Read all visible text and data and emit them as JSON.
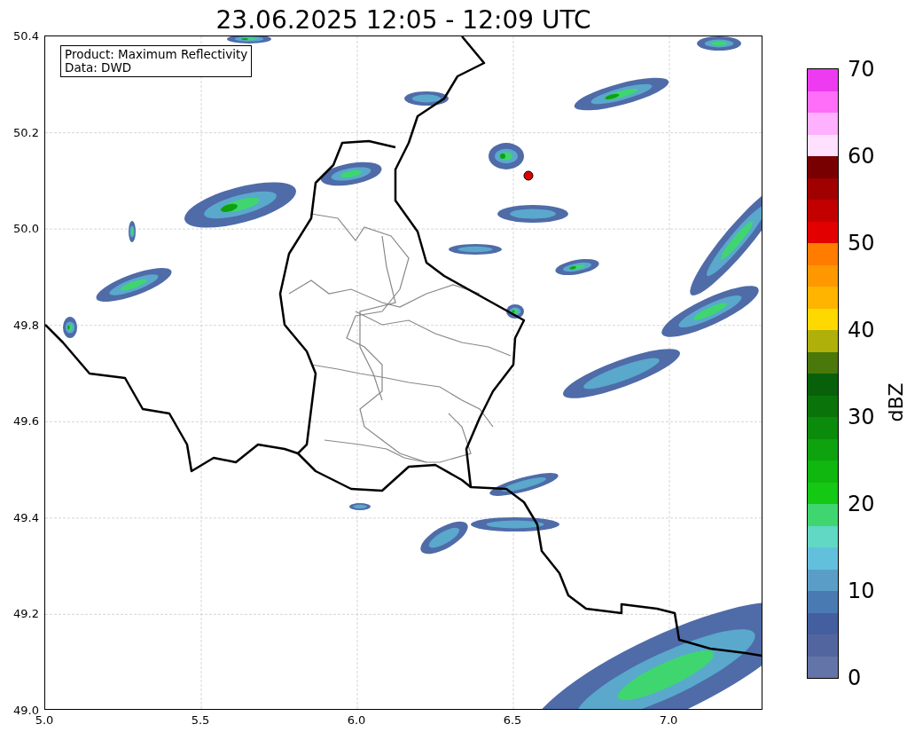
{
  "title": "23.06.2025 12:05 - 12:09 UTC",
  "info_box": {
    "lines": [
      "Product: Maximum Reflectivity",
      "Data: DWD"
    ]
  },
  "x_axis": {
    "ticks": [
      "5.0",
      "5.5",
      "6.0",
      "6.5",
      "7.0"
    ]
  },
  "y_axis": {
    "ticks": [
      "50.4",
      "50.2",
      "50.0",
      "49.8",
      "49.6",
      "49.4",
      "49.2",
      "49.0"
    ]
  },
  "colorbar": {
    "label": "dBZ",
    "ticks": [
      "70",
      "60",
      "50",
      "40",
      "30",
      "20",
      "10",
      "0"
    ],
    "segments": [
      {
        "color": "#6374a8"
      },
      {
        "color": "#53659f"
      },
      {
        "color": "#435fa0"
      },
      {
        "color": "#4a7ab2"
      },
      {
        "color": "#5a9ec8"
      },
      {
        "color": "#62c0dc"
      },
      {
        "color": "#60d8c4"
      },
      {
        "color": "#3fd670"
      },
      {
        "color": "#14c814"
      },
      {
        "color": "#0fb70f"
      },
      {
        "color": "#0ea20e"
      },
      {
        "color": "#0b8b0b"
      },
      {
        "color": "#0a740a"
      },
      {
        "color": "#08600a"
      },
      {
        "color": "#4a780a"
      },
      {
        "color": "#afb00a"
      },
      {
        "color": "#ffd800"
      },
      {
        "color": "#ffb400"
      },
      {
        "color": "#ff9800"
      },
      {
        "color": "#ff7c00"
      },
      {
        "color": "#e20000"
      },
      {
        "color": "#c20000"
      },
      {
        "color": "#a00000"
      },
      {
        "color": "#780000"
      },
      {
        "color": "#ffe0ff"
      },
      {
        "color": "#ffb0ff"
      },
      {
        "color": "#ff6ef8"
      },
      {
        "color": "#ee3af0"
      }
    ]
  }
}
